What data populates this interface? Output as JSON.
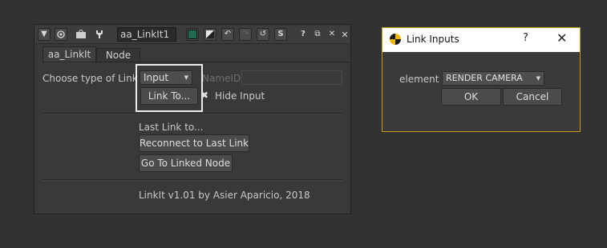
{
  "panel": {
    "node_name": "aa_LinkIt1",
    "tabs": [
      {
        "label": "aa_LinkIt"
      },
      {
        "label": "Node"
      }
    ],
    "choose_label": "Choose type of Link",
    "link_type_value": "Input",
    "nameid_label": "NameID",
    "nameid_value": "",
    "link_to_button": "Link To...",
    "hide_input_label": "Hide Input",
    "last_link_label": "Last Link to...",
    "reconnect_button": "Reconnect to Last Link",
    "goto_button": "Go To Linked Node",
    "version_text": "LinkIt v1.01 by Asier Aparicio, 2018",
    "icons": [
      "collapse-arrow-icon",
      "camera-target-icon",
      "viewer-icon",
      "wrench-icon",
      "color-swatch-icon",
      "split-color-icon",
      "undo-icon",
      "redo-icon",
      "revert-icon",
      "script-icon",
      "help-icon",
      "float-icon",
      "close-icon"
    ],
    "colors": {
      "swatch_green": "#1f6b4f",
      "highlight_box": "#ececec"
    }
  },
  "dialog": {
    "title": "Link Inputs",
    "help": "?",
    "close": "✕",
    "element_label": "element",
    "element_value": "RENDER CAMERA",
    "ok_button": "OK",
    "cancel_button": "Cancel",
    "colors": {
      "border": "#c89820",
      "logo": "#f2b500"
    }
  }
}
